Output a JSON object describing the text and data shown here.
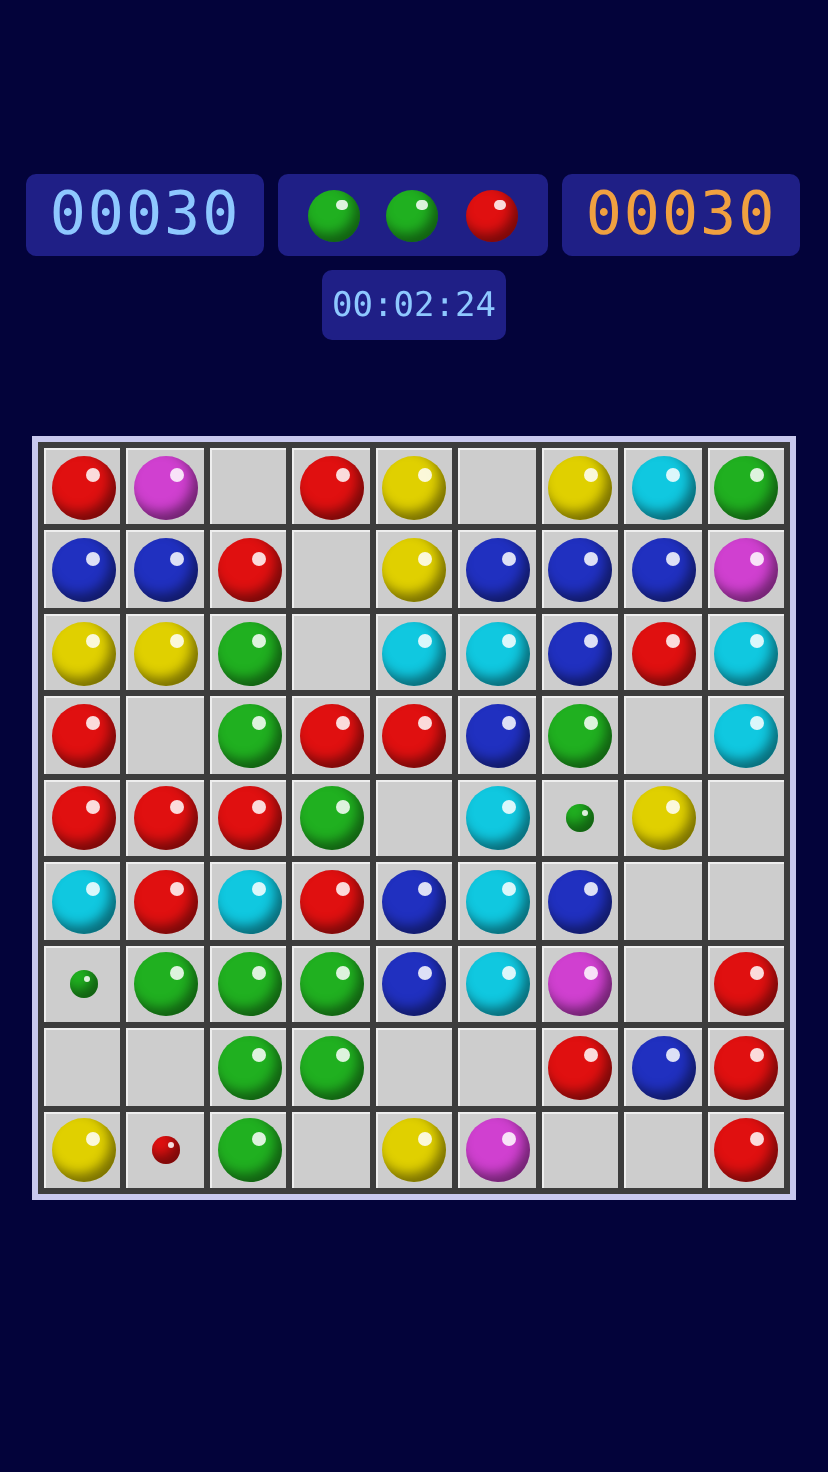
{
  "score": "00030",
  "next_balls": [
    {
      "color": "#20b020"
    },
    {
      "color": "#20b020"
    },
    {
      "color": "#e01010"
    }
  ],
  "best_score": "00030",
  "timer": "00:02:24",
  "board": {
    "rows": [
      [
        {
          "kind": "ball",
          "color": "#e01010"
        },
        {
          "kind": "ball",
          "color": "#d040d0"
        },
        {
          "kind": "empty"
        },
        {
          "kind": "ball",
          "color": "#e01010"
        },
        {
          "kind": "ball",
          "color": "#e0d000"
        },
        {
          "kind": "empty"
        },
        {
          "kind": "ball",
          "color": "#e0d000"
        },
        {
          "kind": "ball",
          "color": "#10c8e0"
        },
        {
          "kind": "ball",
          "color": "#20b020"
        }
      ],
      [
        {
          "kind": "ball",
          "color": "#2030c0"
        },
        {
          "kind": "ball",
          "color": "#2030c0"
        },
        {
          "kind": "ball",
          "color": "#e01010"
        },
        {
          "kind": "empty"
        },
        {
          "kind": "ball",
          "color": "#e0d000"
        },
        {
          "kind": "ball",
          "color": "#2030c0"
        },
        {
          "kind": "ball",
          "color": "#2030c0"
        },
        {
          "kind": "ball",
          "color": "#2030c0"
        },
        {
          "kind": "ball",
          "color": "#d040d0"
        }
      ],
      [
        {
          "kind": "ball",
          "color": "#e0d000"
        },
        {
          "kind": "ball",
          "color": "#e0d000"
        },
        {
          "kind": "ball",
          "color": "#20b020"
        },
        {
          "kind": "empty"
        },
        {
          "kind": "ball",
          "color": "#10c8e0"
        },
        {
          "kind": "ball",
          "color": "#10c8e0"
        },
        {
          "kind": "ball",
          "color": "#2030c0"
        },
        {
          "kind": "ball",
          "color": "#e01010"
        },
        {
          "kind": "ball",
          "color": "#10c8e0"
        }
      ],
      [
        {
          "kind": "ball",
          "color": "#e01010"
        },
        {
          "kind": "empty"
        },
        {
          "kind": "ball",
          "color": "#20b020"
        },
        {
          "kind": "ball",
          "color": "#e01010"
        },
        {
          "kind": "ball",
          "color": "#e01010"
        },
        {
          "kind": "ball",
          "color": "#2030c0"
        },
        {
          "kind": "ball",
          "color": "#20b020"
        },
        {
          "kind": "empty"
        },
        {
          "kind": "ball",
          "color": "#10c8e0"
        }
      ],
      [
        {
          "kind": "ball",
          "color": "#e01010"
        },
        {
          "kind": "ball",
          "color": "#e01010"
        },
        {
          "kind": "ball",
          "color": "#e01010"
        },
        {
          "kind": "ball",
          "color": "#20b020"
        },
        {
          "kind": "empty"
        },
        {
          "kind": "ball",
          "color": "#10c8e0"
        },
        {
          "kind": "small",
          "color": "#20b020"
        },
        {
          "kind": "ball",
          "color": "#e0d000"
        },
        {
          "kind": "empty"
        }
      ],
      [
        {
          "kind": "ball",
          "color": "#10c8e0"
        },
        {
          "kind": "ball",
          "color": "#e01010"
        },
        {
          "kind": "ball",
          "color": "#10c8e0"
        },
        {
          "kind": "ball",
          "color": "#e01010"
        },
        {
          "kind": "ball",
          "color": "#2030c0"
        },
        {
          "kind": "ball",
          "color": "#10c8e0"
        },
        {
          "kind": "ball",
          "color": "#2030c0"
        },
        {
          "kind": "empty"
        },
        {
          "kind": "empty"
        }
      ],
      [
        {
          "kind": "small",
          "color": "#20b020"
        },
        {
          "kind": "ball",
          "color": "#20b020"
        },
        {
          "kind": "ball",
          "color": "#20b020"
        },
        {
          "kind": "ball",
          "color": "#20b020"
        },
        {
          "kind": "ball",
          "color": "#2030c0"
        },
        {
          "kind": "ball",
          "color": "#10c8e0"
        },
        {
          "kind": "ball",
          "color": "#d040d0"
        },
        {
          "kind": "empty"
        },
        {
          "kind": "ball",
          "color": "#e01010"
        }
      ],
      [
        {
          "kind": "empty"
        },
        {
          "kind": "empty"
        },
        {
          "kind": "ball",
          "color": "#20b020"
        },
        {
          "kind": "ball",
          "color": "#20b020"
        },
        {
          "kind": "empty"
        },
        {
          "kind": "empty"
        },
        {
          "kind": "ball",
          "color": "#e01010"
        },
        {
          "kind": "ball",
          "color": "#2030c0"
        },
        {
          "kind": "ball",
          "color": "#e01010"
        }
      ],
      [
        {
          "kind": "ball",
          "color": "#e0d000"
        },
        {
          "kind": "small",
          "color": "#e01010"
        },
        {
          "kind": "ball",
          "color": "#20b020"
        },
        {
          "kind": "empty"
        },
        {
          "kind": "ball",
          "color": "#e0d000"
        },
        {
          "kind": "ball",
          "color": "#d040d0"
        },
        {
          "kind": "empty"
        },
        {
          "kind": "empty"
        },
        {
          "kind": "ball",
          "color": "#e01010"
        }
      ]
    ]
  }
}
